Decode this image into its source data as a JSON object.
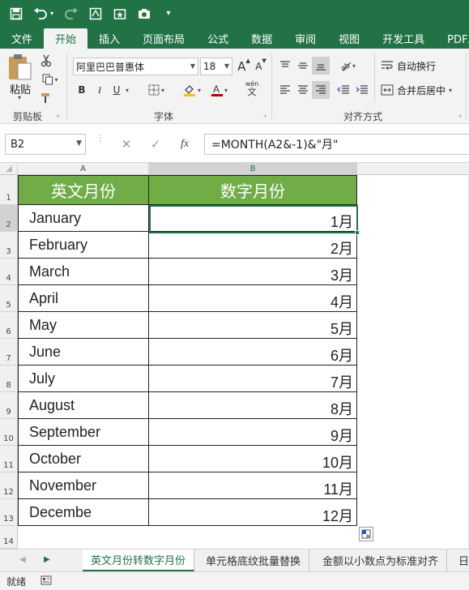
{
  "titlebar": {
    "icons": [
      "save-icon",
      "undo-icon",
      "redo-icon",
      "form-icon",
      "camera-icon",
      "chevron-down-icon"
    ]
  },
  "ribbon_tabs": [
    {
      "label": "文件",
      "active": false
    },
    {
      "label": "开始",
      "active": true
    },
    {
      "label": "插入",
      "active": false
    },
    {
      "label": "页面布局",
      "active": false
    },
    {
      "label": "公式",
      "active": false
    },
    {
      "label": "数据",
      "active": false
    },
    {
      "label": "审阅",
      "active": false
    },
    {
      "label": "视图",
      "active": false
    },
    {
      "label": "开发工具",
      "active": false
    },
    {
      "label": "PDF工",
      "active": false
    }
  ],
  "ribbon": {
    "paste_label": "粘贴",
    "clipboard_label": "剪贴板",
    "font_name": "阿里巴巴普惠体",
    "font_size": "18",
    "font_group_label": "字体",
    "bold": "B",
    "italic": "I",
    "underline": "U",
    "wen_label": "wén",
    "wrap_text": "自动换行",
    "merge_center": "合并后居中",
    "align_group_label": "对齐方式"
  },
  "formula_bar": {
    "name_box": "B2",
    "fx": "fx",
    "formula": "=MONTH(A2&-1)&\"月\""
  },
  "columns": [
    "A",
    "B"
  ],
  "header_row": [
    "英文月份",
    "数字月份"
  ],
  "rows": [
    {
      "num": "2",
      "a": "January",
      "b": "1月"
    },
    {
      "num": "3",
      "a": "February",
      "b": "2月"
    },
    {
      "num": "4",
      "a": "March",
      "b": "3月"
    },
    {
      "num": "5",
      "a": "April",
      "b": "4月"
    },
    {
      "num": "6",
      "a": "May",
      "b": "5月"
    },
    {
      "num": "7",
      "a": "June",
      "b": "6月"
    },
    {
      "num": "8",
      "a": "July",
      "b": "7月"
    },
    {
      "num": "9",
      "a": "August",
      "b": "8月"
    },
    {
      "num": "10",
      "a": "September",
      "b": "9月"
    },
    {
      "num": "11",
      "a": "October",
      "b": "10月"
    },
    {
      "num": "12",
      "a": "November",
      "b": "11月"
    },
    {
      "num": "13",
      "a": "Decembe",
      "b": "12月"
    }
  ],
  "row_numbers": [
    "1",
    "14"
  ],
  "sheets": [
    {
      "label": "英文月份转数字月份",
      "active": true
    },
    {
      "label": "单元格底纹批量替换",
      "active": false
    },
    {
      "label": "金额以小数点为标准对齐",
      "active": false
    },
    {
      "label": "日",
      "active": false
    }
  ],
  "status": {
    "ready": "就绪"
  },
  "colors": {
    "brand": "#217346",
    "header_fill": "#70ad47"
  }
}
